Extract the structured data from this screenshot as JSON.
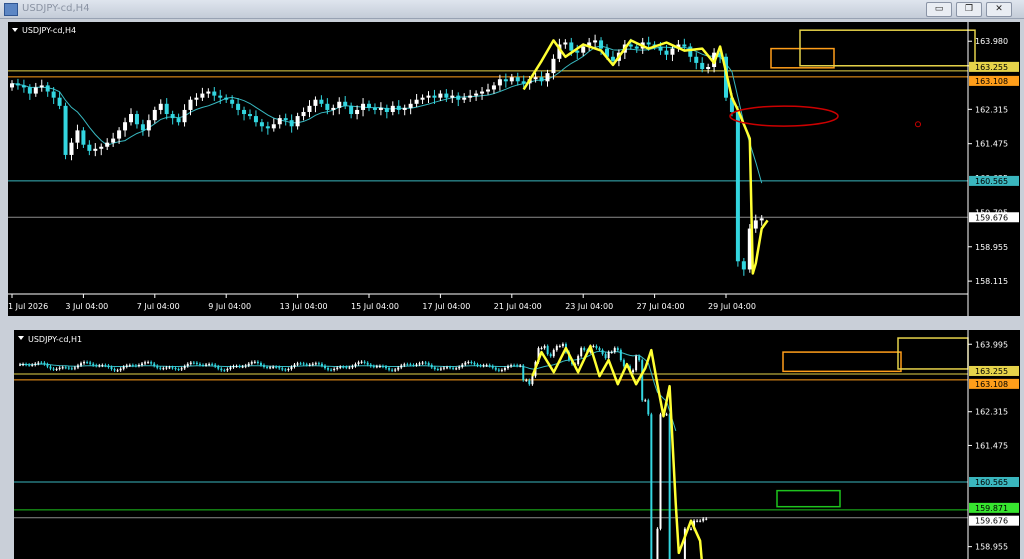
{
  "window": {
    "title": "USDJPY-cd,H4",
    "buttons": {
      "minimize": "▭",
      "restore": "❐",
      "close": "✕"
    }
  },
  "colors": {
    "background": "#000000",
    "bull_candle": "#ffffff",
    "bear_candle": "#33d6e0",
    "moving_average": "#38b8c0",
    "drawing": "#ffff33",
    "level_orange": "#ff9e1a",
    "level_yellow": "#e6d34a",
    "level_cyan": "#3ab6be",
    "level_grey": "#8c8c8c",
    "ellipse": "#cc0000",
    "green_box": "#1ec41e",
    "green_label": "#37e62f"
  },
  "chart_data": [
    {
      "type": "candlestick",
      "symbol": "USDJPY-cd",
      "timeframe": "H4",
      "label": "USDJPY-cd,H4",
      "ylim": [
        157.8,
        164.45
      ],
      "y_ticks": [
        "163.980",
        "162.315",
        "161.475",
        "158.955",
        "158.115"
      ],
      "price_labels": [
        "163.255",
        "163.108",
        "160.565",
        "159.676"
      ],
      "partial_labels": [
        "160.635",
        "159.795"
      ],
      "x_ticks": [
        "1 Jul 2026",
        "3 Jul 04:00",
        "7 Jul 04:00",
        "9 Jul 04:00",
        "13 Jul 04:00",
        "15 Jul 04:00",
        "17 Jul 04:00",
        "21 Jul 04:00",
        "23 Jul 04:00",
        "27 Jul 04:00",
        "29 Jul 04:00"
      ],
      "levels": [
        {
          "price": 163.255,
          "color": "#e6d34a"
        },
        {
          "price": 163.108,
          "color": "#ff9e1a"
        },
        {
          "price": 160.565,
          "color": "#3ab6be"
        },
        {
          "price": 159.676,
          "color": "#8c8c8c"
        }
      ],
      "close_series": [
        162.95,
        162.9,
        162.85,
        162.7,
        162.85,
        162.9,
        162.75,
        162.6,
        162.4,
        161.2,
        161.5,
        161.8,
        161.45,
        161.3,
        161.35,
        161.4,
        161.5,
        161.6,
        161.8,
        162.0,
        162.2,
        161.95,
        161.8,
        162.05,
        162.3,
        162.45,
        162.2,
        162.1,
        162.0,
        162.3,
        162.55,
        162.6,
        162.7,
        162.75,
        162.65,
        162.6,
        162.55,
        162.45,
        162.3,
        162.2,
        162.15,
        162.0,
        161.9,
        161.85,
        161.95,
        162.1,
        162.05,
        161.9,
        162.15,
        162.25,
        162.4,
        162.55,
        162.45,
        162.3,
        162.35,
        162.5,
        162.4,
        162.2,
        162.3,
        162.45,
        162.35,
        162.3,
        162.35,
        162.25,
        162.4,
        162.3,
        162.35,
        162.45,
        162.55,
        162.6,
        162.65,
        162.6,
        162.7,
        162.6,
        162.65,
        162.55,
        162.6,
        162.65,
        162.7,
        162.75,
        162.8,
        162.9,
        163.05,
        163.0,
        163.1,
        163.0,
        162.95,
        163.05,
        163.1,
        163.0,
        163.2,
        163.55,
        163.9,
        163.95,
        163.75,
        163.7,
        163.85,
        163.95,
        164.0,
        163.8,
        163.6,
        163.5,
        163.7,
        163.9,
        163.85,
        163.8,
        163.95,
        163.9,
        163.85,
        163.75,
        163.65,
        163.8,
        163.9,
        163.85,
        163.6,
        163.45,
        163.3,
        163.35,
        163.7,
        163.6,
        162.6,
        162.25,
        158.6,
        158.4,
        159.4,
        159.6,
        159.65
      ],
      "drawings": [
        "zigzag-yellow",
        "ellipse-red",
        "rectangle-orange",
        "rectangle-yellow",
        "dot-red"
      ]
    },
    {
      "type": "candlestick",
      "symbol": "USDJPY-cd",
      "timeframe": "H1",
      "label": "USDJPY-cd,H1",
      "ylim": [
        157.95,
        164.35
      ],
      "y_ticks": [
        "163.995",
        "162.315",
        "161.475",
        "158.955"
      ],
      "price_labels": [
        "163.255",
        "163.108",
        "160.565",
        "159.871",
        "159.676"
      ],
      "levels": [
        {
          "price": 163.255,
          "color": "#e6d34a"
        },
        {
          "price": 163.108,
          "color": "#ff9e1a"
        },
        {
          "price": 160.565,
          "color": "#3ab6be"
        },
        {
          "price": 159.871,
          "color": "#1ec41e"
        },
        {
          "price": 159.676,
          "color": "#8c8c8c"
        }
      ],
      "drawings": [
        "zigzag-yellow",
        "rectangle-orange",
        "rectangle-yellow",
        "rectangle-green"
      ]
    }
  ]
}
